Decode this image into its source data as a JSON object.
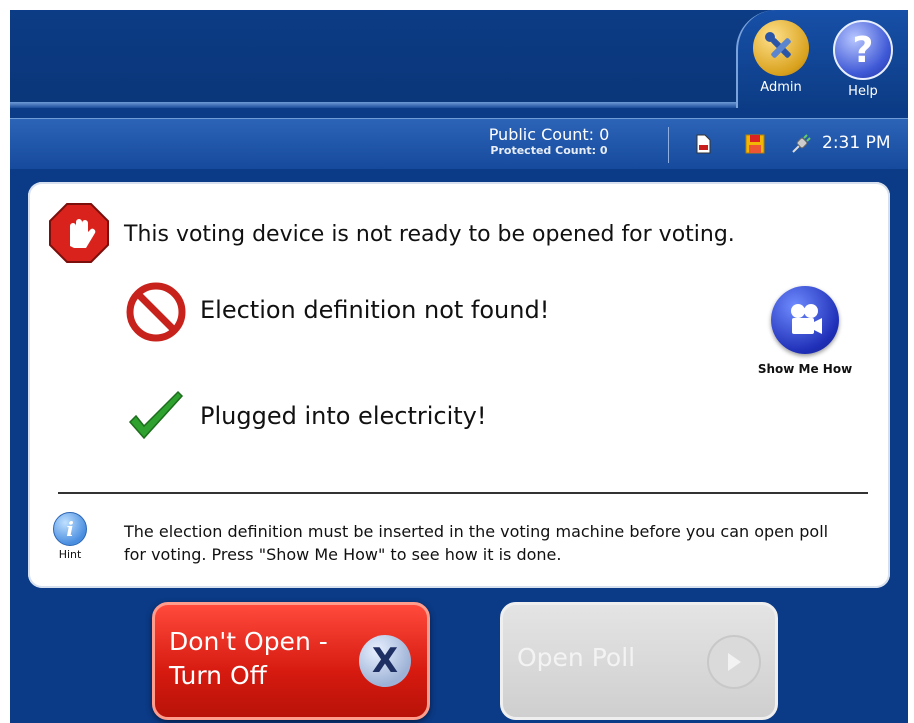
{
  "header": {
    "admin_label": "Admin",
    "help_label": "Help",
    "admin_icon": "tools-icon",
    "help_icon": "question-icon"
  },
  "status_bar": {
    "public_count": "Public Count: 0",
    "protected_count": "Protected Count: 0",
    "time": "2:31 PM",
    "icons": [
      "document-icon",
      "save-icon",
      "power-plug-icon"
    ]
  },
  "panel": {
    "headline": "This voting device is not ready to be opened for voting.",
    "checks": [
      {
        "label": "Election definition not found!",
        "status": "fail",
        "icon": "prohibited-icon"
      },
      {
        "label": "Plugged into electricity!",
        "status": "ok",
        "icon": "checkmark-icon"
      }
    ],
    "show_me_how_label": "Show Me How",
    "hint_label": "Hint",
    "hint_text": "The election definition must be inserted in the voting machine before you can open poll for voting.  Press \"Show Me How\" to see how it is done."
  },
  "buttons": {
    "dont_open_line1": "Don't Open -",
    "dont_open_line2": "Turn Off",
    "open_poll": "Open Poll",
    "open_poll_enabled": false
  },
  "colors": {
    "background": "#0b3a86",
    "danger": "#d61a10",
    "ok": "#2ea12e",
    "disabled": "#d4d4d4"
  }
}
